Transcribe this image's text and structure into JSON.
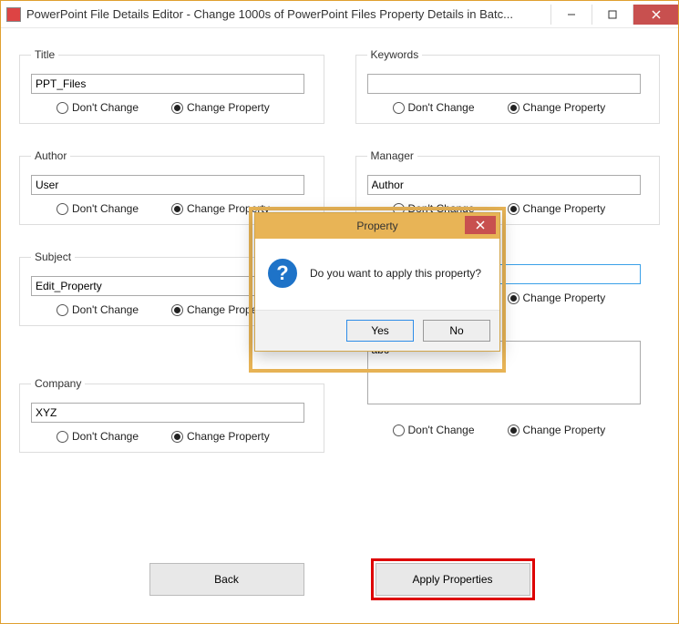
{
  "window": {
    "title": "PowerPoint File Details Editor - Change 1000s of PowerPoint Files Property Details in Batc..."
  },
  "radio_labels": {
    "dont_change": "Don't Change",
    "change_property": "Change Property"
  },
  "fields": {
    "title": {
      "legend": "Title",
      "value": "PPT_Files",
      "selected": "change"
    },
    "author": {
      "legend": "Author",
      "value": "User",
      "selected": "change"
    },
    "subject": {
      "legend": "Subject",
      "value": "Edit_Property",
      "selected": "change"
    },
    "company": {
      "legend": "Company",
      "value": "XYZ",
      "selected": "change"
    },
    "keywords": {
      "legend": "Keywords",
      "value": "",
      "selected": "change"
    },
    "manager": {
      "legend": "Manager",
      "value": "Author",
      "selected": "change"
    },
    "hidden": {
      "legend": "",
      "value": "",
      "selected": "change"
    },
    "comments": {
      "legend": "",
      "value": "abc",
      "selected": "change"
    }
  },
  "buttons": {
    "back": "Back",
    "apply": "Apply Properties"
  },
  "dialog": {
    "title": "Property",
    "message": "Do you want to apply this property?",
    "yes": "Yes",
    "no": "No"
  }
}
